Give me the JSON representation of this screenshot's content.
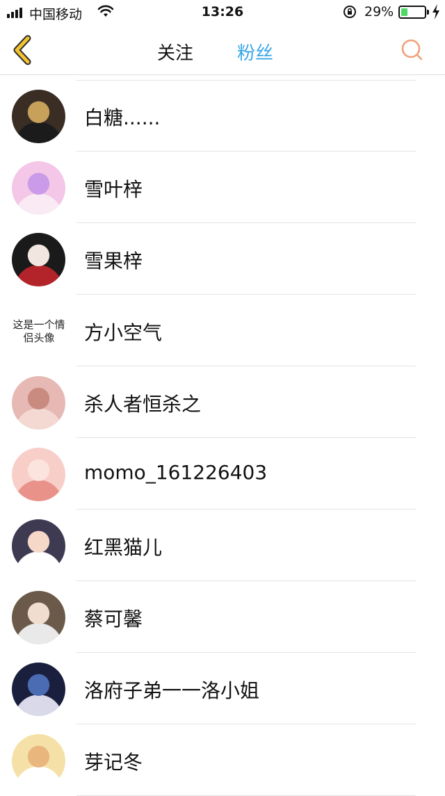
{
  "status_bar": {
    "carrier": "中国移动",
    "time": "13:26",
    "battery_percent": "29%",
    "battery_level": 0.29,
    "icons": [
      "signal-icon",
      "wifi-icon",
      "rotation-lock-icon",
      "battery-icon",
      "charging-icon"
    ]
  },
  "nav": {
    "back_icon": "chevron-left-icon",
    "tabs": [
      {
        "label": "关注",
        "active": false
      },
      {
        "label": "粉丝",
        "active": true
      }
    ],
    "search_icon": "search-icon",
    "colors": {
      "active_tab": "#3aa7e8",
      "back": "#f2c230",
      "search": "#f0a077"
    }
  },
  "fans": [
    {
      "name": "白糖......",
      "avatar": {
        "type": "image",
        "colors": [
          "#3a2d24",
          "#c7a05a",
          "#1b1b1b"
        ]
      }
    },
    {
      "name": "雪叶梓",
      "avatar": {
        "type": "image",
        "colors": [
          "#f4c6e8",
          "#c99be8",
          "#f9eaf3"
        ]
      }
    },
    {
      "name": "雪果梓",
      "avatar": {
        "type": "image",
        "colors": [
          "#1a1a1a",
          "#f1e6e0",
          "#b3232a"
        ]
      }
    },
    {
      "name": "方小空气",
      "avatar": {
        "type": "text",
        "text": "这是一个情侣头像"
      }
    },
    {
      "name": "杀人者恒杀之",
      "avatar": {
        "type": "image",
        "colors": [
          "#e7b9b5",
          "#c98b80",
          "#f4d9d3"
        ]
      }
    },
    {
      "name": "momo_161226403",
      "avatar": {
        "type": "image",
        "colors": [
          "#f8cfc8",
          "#fbe3de",
          "#e9928a"
        ]
      }
    },
    {
      "name": "红黑猫儿",
      "avatar": {
        "type": "image",
        "colors": [
          "#3d3a52",
          "#f6d8c9",
          "#ffffff"
        ]
      }
    },
    {
      "name": "蔡可馨",
      "avatar": {
        "type": "image",
        "colors": [
          "#6b5a4a",
          "#f1ddd0",
          "#e9e9e9"
        ]
      }
    },
    {
      "name": "洛府子弟一一洛小姐",
      "avatar": {
        "type": "image",
        "colors": [
          "#1a1f3e",
          "#4b6bb3",
          "#d9d9e9"
        ]
      }
    },
    {
      "name": "芽记冬",
      "avatar": {
        "type": "image",
        "colors": [
          "#f5e1a8",
          "#e9b77e",
          "#ffffff"
        ]
      }
    }
  ]
}
